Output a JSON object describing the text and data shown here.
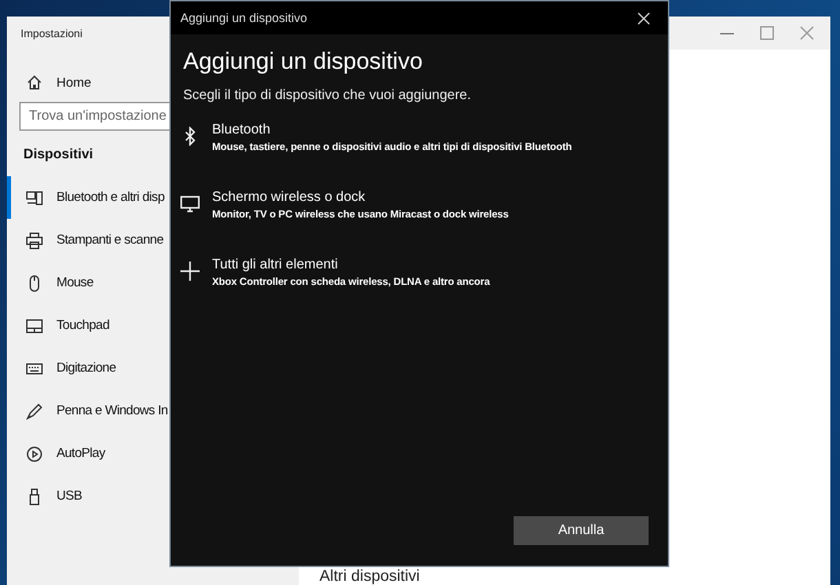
{
  "settings_window": {
    "title": "Impostazioni"
  },
  "sidebar": {
    "home": "Home",
    "search": {
      "placeholder": "Trova un'impostazione"
    },
    "section": "Dispositivi",
    "items": [
      {
        "label": "Bluetooth e altri disp",
        "kind": "devices",
        "selected": true
      },
      {
        "label": "Stampanti e scanne",
        "kind": "printer",
        "selected": false
      },
      {
        "label": "Mouse",
        "kind": "mouse",
        "selected": false
      },
      {
        "label": "Touchpad",
        "kind": "touchpad",
        "selected": false
      },
      {
        "label": "Digitazione",
        "kind": "keyboard",
        "selected": false
      },
      {
        "label": "Penna e Windows In",
        "kind": "pen",
        "selected": false
      },
      {
        "label": "AutoPlay",
        "kind": "autoplay",
        "selected": false
      },
      {
        "label": "USB",
        "kind": "usb",
        "selected": false
      }
    ]
  },
  "main": {
    "heading": "Altri dispositivi"
  },
  "dialog": {
    "title": "Aggiungi un dispositivo",
    "heading": "Aggiungi un dispositivo",
    "subtitle": "Scegli il tipo di dispositivo che vuoi aggiungere.",
    "options": [
      {
        "kind": "bluetooth",
        "title": "Bluetooth",
        "description": "Mouse, tastiere, penne o dispositivi audio e altri tipi di dispositivi Bluetooth"
      },
      {
        "kind": "display",
        "title": "Schermo wireless o dock",
        "description": "Monitor, TV o PC wireless che usano Miracast o dock wireless"
      },
      {
        "kind": "plus",
        "title": "Tutti gli altri elementi",
        "description": "Xbox Controller con scheda wireless, DLNA e altro ancora"
      }
    ],
    "cancel_button": "Annulla"
  }
}
